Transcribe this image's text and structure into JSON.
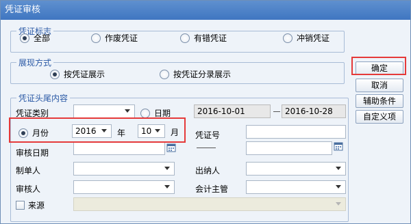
{
  "window": {
    "title": "凭证审核"
  },
  "voucher_flag": {
    "legend": "凭证标志",
    "options": [
      {
        "label": "全部",
        "selected": true
      },
      {
        "label": "作废凭证",
        "selected": false
      },
      {
        "label": "有错凭证",
        "selected": false
      },
      {
        "label": "冲销凭证",
        "selected": false
      }
    ]
  },
  "display_mode": {
    "legend": "展现方式",
    "options": [
      {
        "label": "按凭证展示",
        "selected": true
      },
      {
        "label": "按凭证分录展示",
        "selected": false
      }
    ]
  },
  "header_footer": {
    "legend": "凭证头尾内容",
    "voucher_type_label": "凭证类别",
    "voucher_type_value": "",
    "date_radio_label": "日期",
    "date_from": "2016-10-01",
    "date_to": "2016-10-28",
    "month_radio_label": "月份",
    "year_value": "2016",
    "year_unit": "年",
    "month_value": "10",
    "month_unit": "月",
    "voucher_no_label": "凭证号",
    "voucher_no_from": "",
    "voucher_no_to": "",
    "audit_date_label": "审核日期",
    "audit_date_from": "",
    "audit_date_to": "",
    "maker_label": "制单人",
    "maker_value": "",
    "cashier_label": "出纳人",
    "cashier_value": "",
    "auditor_label": "审核人",
    "auditor_value": "",
    "supervisor_label": "会计主管",
    "supervisor_value": "",
    "source_label": "来源",
    "source_value": ""
  },
  "buttons": {
    "confirm": "确定",
    "cancel": "取消",
    "auxiliary": "辅助条件",
    "custom": "自定义项"
  },
  "colors": {
    "title_bar": "#4a80c8",
    "legend_text": "#2a59a5",
    "highlight": "#e53939"
  }
}
